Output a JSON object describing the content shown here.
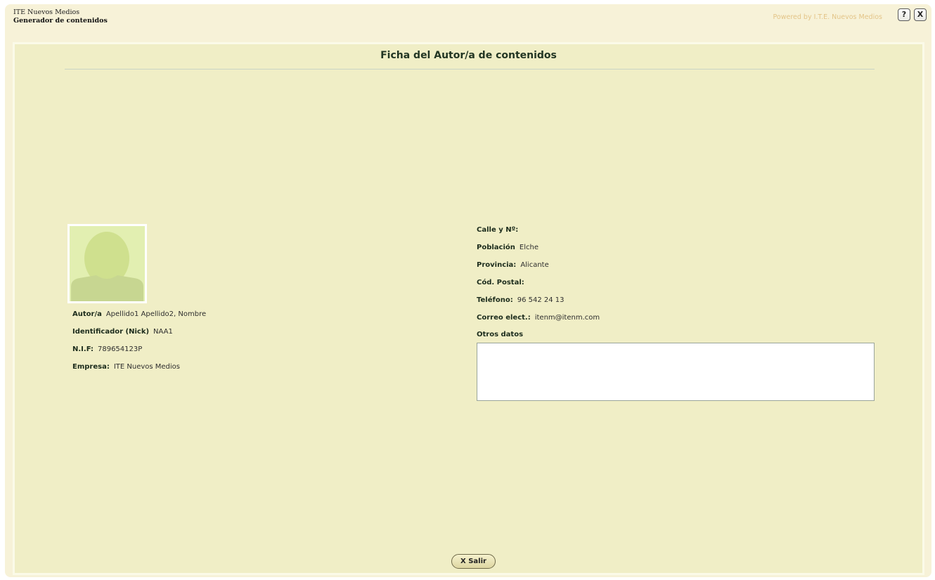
{
  "header": {
    "org": "ITE Nuevos Medios",
    "app": "Generador de contenidos",
    "powered_by": "Powered by I.T.E. Nuevos Medios",
    "help_label": "?",
    "close_label": "X"
  },
  "panel": {
    "title": "Ficha del Autor/a de contenidos"
  },
  "author": {
    "photo_icon": "avatar-placeholder-icon",
    "fields": [
      {
        "label": "Autor/a",
        "value": "Apellido1 Apellido2, Nombre"
      },
      {
        "label": "Identificador (Nick)",
        "value": "NAA1"
      },
      {
        "label": "N.I.F:",
        "value": "789654123P"
      },
      {
        "label": "Empresa:",
        "value": "ITE Nuevos Medios"
      }
    ]
  },
  "contact": {
    "fields": [
      {
        "label": "Calle y Nº:",
        "value": ""
      },
      {
        "label": "Población",
        "value": "Elche"
      },
      {
        "label": "Provincia:",
        "value": "Alicante"
      },
      {
        "label": "Cód. Postal:",
        "value": ""
      },
      {
        "label": "Teléfono:",
        "value": "96 542 24 13"
      },
      {
        "label": "Correo elect.:",
        "value": "itenm@itenm.com"
      }
    ],
    "otros_label": "Otros datos",
    "otros_value": ""
  },
  "footer": {
    "salir_label": "X Salir"
  },
  "colors": {
    "background": "#f7f2d8",
    "panel": "#f0eec6",
    "powered_text": "#e3c487",
    "avatar_bg": "#e2efb1",
    "avatar_figure": "#cfe08e"
  }
}
